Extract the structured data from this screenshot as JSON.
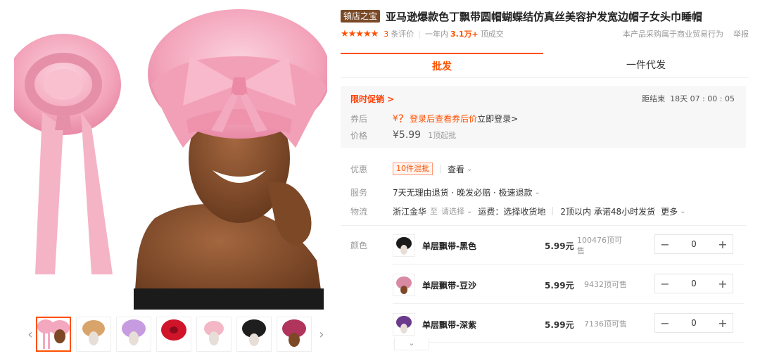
{
  "product": {
    "shop_badge": "镇店之宝",
    "title": "亚马逊爆款色丁飘带圆帽蝴蝶结仿真丝美容护发宽边帽子女头巾睡帽",
    "stars": "★★★★★",
    "review_count": "3",
    "review_label": "条评价",
    "sales_label": "一年内",
    "sales_count": "3.1万+",
    "sales_unit": "顶成交",
    "trade_note": "本产品采购属于商业贸易行为",
    "report": "举报"
  },
  "tabs": [
    {
      "label": "批发"
    },
    {
      "label": "一件代发"
    }
  ],
  "promo": {
    "title": "限时促销 >",
    "countdown_label": "距结束",
    "countdown": "18天 07 : 00 : 05",
    "coupon_label": "券后",
    "coupon_yen": "¥",
    "coupon_q": "?",
    "coupon_link": "登录后查看券后价",
    "coupon_login": "立即登录>",
    "price_label": "价格",
    "price": "¥5.99",
    "moq": "1顶起批"
  },
  "attrs": {
    "discount_label": "优惠",
    "discount_tag": "10件混批",
    "discount_view": "查看",
    "service_label": "服务",
    "service_text": "7天无理由退货 · 晚发必赔 · 极速退款",
    "logistics_label": "物流",
    "origin": "浙江金华",
    "to": "至",
    "dest": "请选择",
    "freight": "运费：选择收货地",
    "ship_promise": "2顶以内 承诺48小时发货",
    "more": "更多"
  },
  "sku": {
    "label": "颜色",
    "items": [
      {
        "name": "单层飘带-黑色",
        "price": "5.99元",
        "stock": "100476顶可售",
        "qty": "0",
        "color": "#1a1a1a"
      },
      {
        "name": "单层飘带-豆沙",
        "price": "5.99元",
        "stock": "9432顶可售",
        "qty": "0",
        "color": "#d88aa3"
      },
      {
        "name": "单层飘带-深紫",
        "price": "5.99元",
        "stock": "7136顶可售",
        "qty": "0",
        "color": "#6b3a8c"
      }
    ],
    "minus": "−",
    "plus": "+"
  },
  "gallery": {
    "thumb_colors": [
      "#f4a8c0",
      "#d9a46a",
      "#c79be0",
      "#d0142a",
      "#f4b7c6",
      "#1e1e1e",
      "#b0345c"
    ],
    "prev": "‹",
    "next": "›"
  },
  "colors": {
    "accent": "#ff5000",
    "pink_satin": "#f5a9bf"
  }
}
